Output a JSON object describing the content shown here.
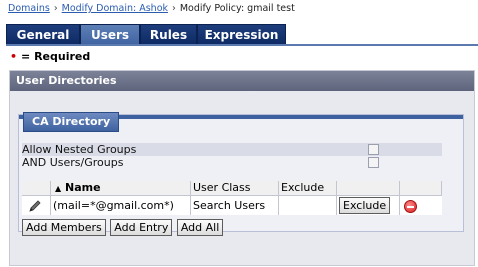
{
  "breadcrumb": {
    "domains": "Domains",
    "modify_domain": "Modify Domain: Ashok",
    "current": "Modify Policy: gmail test",
    "separator": "›"
  },
  "tabs": [
    {
      "label": "General",
      "active": false
    },
    {
      "label": "Users",
      "active": true
    },
    {
      "label": "Rules",
      "active": false
    },
    {
      "label": "Expression",
      "active": false
    }
  ],
  "required_note": {
    "bullet": "•",
    "text": "= Required"
  },
  "user_directories": {
    "title": "User Directories",
    "ca_directory": {
      "title": "CA Directory",
      "options": [
        {
          "label": "Allow Nested Groups",
          "checked": false
        },
        {
          "label": "AND Users/Groups",
          "checked": false
        }
      ],
      "columns": {
        "name": "Name",
        "user_class": "User Class",
        "exclude": "Exclude"
      },
      "sort_indicator": "▲",
      "rows": [
        {
          "name": "(mail=*@gmail.com*)",
          "user_class": "Search Users",
          "exclude": "",
          "exclude_button": "Exclude"
        }
      ],
      "buttons": {
        "add_members": "Add Members",
        "add_entry": "Add Entry",
        "add_all": "Add All"
      }
    }
  },
  "colors": {
    "tab_dark": "#0d2a63",
    "tab_active": "#3e62a0",
    "header_gray": "#5d647c",
    "link": "#2a5db0",
    "required_dot": "#cc0000"
  },
  "icons": {
    "edit": "pencil-icon",
    "remove": "remove-circle-icon",
    "sort": "sort-ascending-icon"
  }
}
